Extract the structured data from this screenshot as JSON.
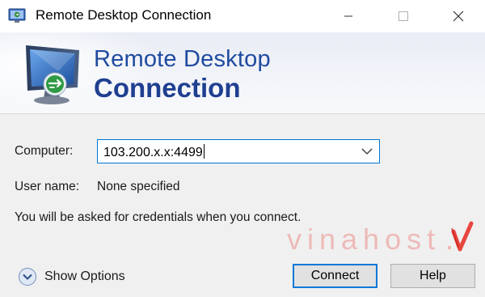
{
  "window": {
    "title": "Remote Desktop Connection",
    "controls": {
      "minimize": "minimize",
      "maximize": "maximize",
      "close": "close"
    }
  },
  "banner": {
    "line1": "Remote Desktop",
    "line2": "Connection",
    "icon": "remote-desktop-monitor-icon"
  },
  "form": {
    "computer_label": "Computer:",
    "computer_value": "103.200.x.x:4499",
    "user_label": "User name:",
    "user_value": "None specified",
    "info_text": "You will be asked for credentials when you connect."
  },
  "watermark": {
    "text": "vinahost"
  },
  "footer": {
    "show_options_label": "Show Options",
    "connect_label": "Connect",
    "help_label": "Help"
  },
  "colors": {
    "accent": "#0078d7",
    "banner_text": "#1f4ba0",
    "watermark_red": "#e8322b"
  }
}
